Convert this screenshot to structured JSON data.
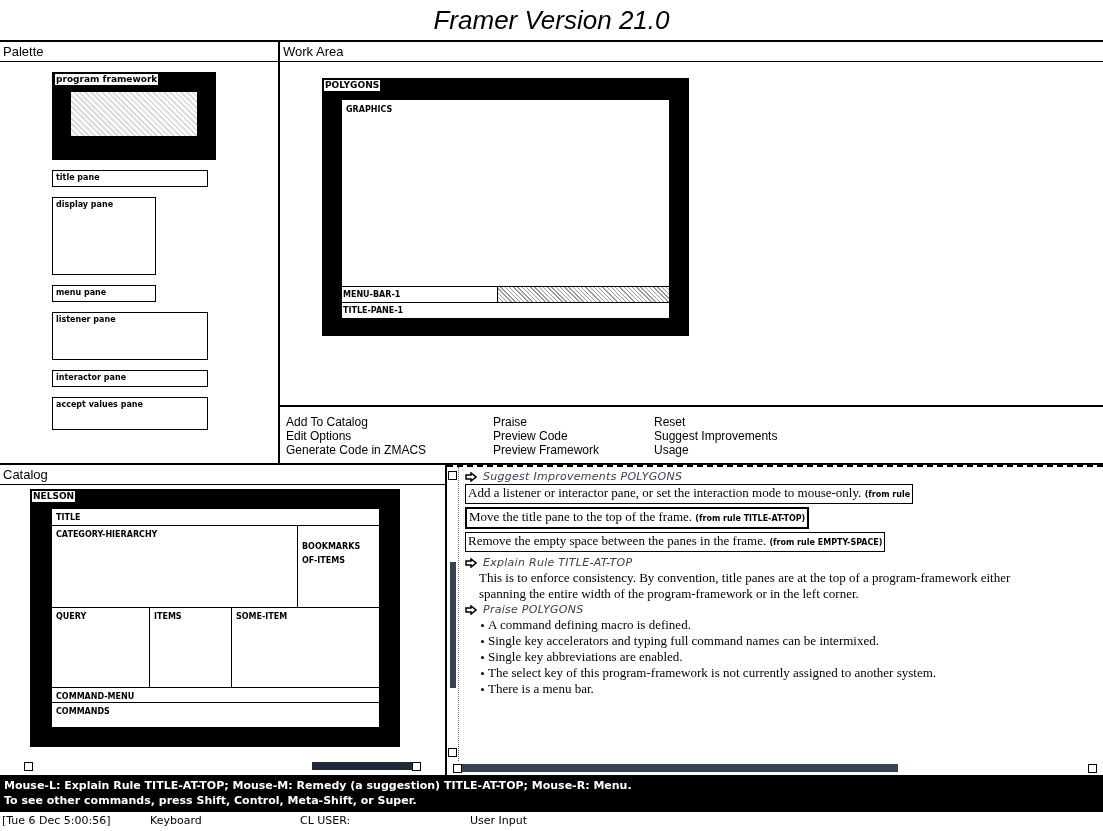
{
  "title": "Framer Version 21.0",
  "palette": {
    "title": "Palette",
    "items": [
      "program framework",
      "title pane",
      "display pane",
      "menu pane",
      "listener pane",
      "interactor pane",
      "accept values pane"
    ]
  },
  "work_area": {
    "title": "Work Area",
    "frame": {
      "name": "POLYGONS",
      "panes": [
        "GRAPHICS",
        "MENU-BAR-1",
        "TITLE-PANE-1"
      ]
    }
  },
  "commands": [
    [
      "Add To Catalog",
      "Edit Options",
      "Generate Code in ZMACS"
    ],
    [
      "Praise",
      "Preview Code",
      "Preview Framework"
    ],
    [
      "Reset",
      "Suggest Improvements",
      "Usage"
    ]
  ],
  "catalog": {
    "title": "Catalog",
    "frame": {
      "name": "NELSON",
      "panes": [
        "TITLE",
        "CATEGORY-HIERARCHY",
        "BOOKMARKS OF-ITEMS",
        "QUERY",
        "ITEMS",
        "SOME-ITEM",
        "COMMAND-MENU",
        "COMMANDS"
      ]
    }
  },
  "output": {
    "sections": [
      {
        "kind": "suggestions",
        "heading": "Suggest Improvements POLYGONS",
        "items": [
          {
            "text": "Add a listener or interactor pane, or set the interaction mode to mouse-only.",
            "rule": "(from rule",
            "selected": false
          },
          {
            "text": "Move the title pane to the top of the frame.",
            "rule": "(from rule TITLE-AT-TOP)",
            "selected": true
          },
          {
            "text": "Remove the empty space between the panes in the frame.",
            "rule": "(from rule EMPTY-SPACE)",
            "selected": false
          }
        ]
      },
      {
        "kind": "explanation",
        "heading": "Explain Rule TITLE-AT-TOP",
        "text": "This is to enforce consistency.  By convention, title panes are at the top of a program-framework either spanning the entire width of the program-framework or in the left corner."
      },
      {
        "kind": "praise",
        "heading": "Praise POLYGONS",
        "items": [
          "A command defining macro is defined.",
          "Single key accelerators and typing full command names can be intermixed.",
          "Single key abbreviations are enabled.",
          "The select key of this program-framework is not currently assigned to another system.",
          "There is a menu bar."
        ]
      }
    ]
  },
  "mouse_doc": [
    "Mouse-L: Explain Rule TITLE-AT-TOP; Mouse-M: Remedy (a suggestion) TITLE-AT-TOP; Mouse-R: Menu.",
    "To see other commands, press Shift, Control, Meta-Shift, or Super."
  ],
  "status_bar": [
    "[Tue 6 Dec 5:00:56]",
    "Keyboard",
    "CL USER:",
    "User Input"
  ]
}
